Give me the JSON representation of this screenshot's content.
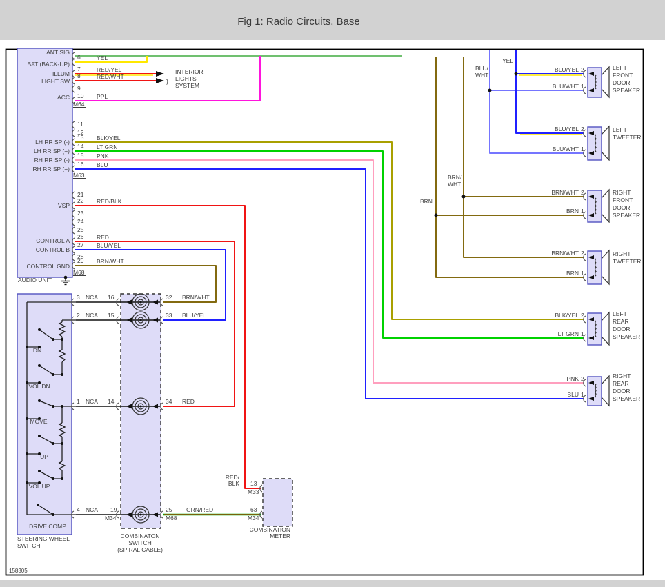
{
  "header": {
    "title": "Fig 1: Radio Circuits, Base"
  },
  "doc_number": "158305",
  "colors": {
    "ant_green": "#70c070",
    "yellow": "#ffe800",
    "red": "#f01414",
    "magenta": "#ff14dd",
    "olive_blk_yel": "#a9a000",
    "lt_grn": "#00d200",
    "pink": "#ff9fbe",
    "blue": "#2020ff",
    "blu_wht": "#7575ff",
    "brown": "#836a10",
    "lavender_box": "#dedcf8",
    "box_border": "#5353c0"
  },
  "audio_unit": {
    "label": "AUDIO UNIT",
    "pin_labels": {
      "ant_sig": "ANT SIG",
      "bat": "BAT (BACK-UP)",
      "illum": "ILLUM",
      "light_sw": "LIGHT SW",
      "acc": "ACC",
      "lh_rr_sp_neg": "LH RR SP (-)",
      "lh_rr_sp_pos": "LH RR SP (+)",
      "rh_rr_sp_neg": "RH RR SP (-)",
      "rh_rr_sp_pos": "RH RR SP (+)",
      "vsp": "VSP",
      "control_a": "CONTROL A",
      "control_b": "CONTROL B",
      "control_gnd": "CONTROL GND"
    },
    "pin_numbers": {
      "p6": "6",
      "p7": "7",
      "p8": "8",
      "p9": "9",
      "p10": "10",
      "p11": "11",
      "p12": "12",
      "p13": "13",
      "p14": "14",
      "p15": "15",
      "p16": "16",
      "p21": "21",
      "p22": "22",
      "p23": "23",
      "p24": "24",
      "p25": "25",
      "p26": "26",
      "p27": "27",
      "p28": "28",
      "p29": "29"
    },
    "wire_labels": {
      "yel": "YEL",
      "red_yel": "RED/YEL",
      "red_wht": "RED/WHT",
      "ppl": "PPL",
      "blk_yel": "BLK/YEL",
      "lt_grn": "LT GRN",
      "pnk": "PNK",
      "blu": "BLU",
      "red_blk": "RED/BLK",
      "red": "RED",
      "blu_yel": "BLU/YEL",
      "brn_wht": "BRN/WHT"
    },
    "connectors": {
      "m64": "M64",
      "m63": "M63",
      "m68": "M68"
    }
  },
  "interior_lights": {
    "line1": "INTERIOR",
    "line2": "LIGHTS",
    "line3": "SYSTEM",
    "brace": "}"
  },
  "steering_wheel_switch": {
    "label1": "STEERING WHEEL",
    "label2": "SWITCH",
    "switches": [
      "DN",
      "VOL DN",
      "MOVE",
      "UP",
      "VOL UP",
      "DRIVE COMP"
    ],
    "pins_left": [
      "3",
      "2",
      "1",
      "4"
    ],
    "nca": "NCA",
    "pins_right": [
      "16",
      "15",
      "14",
      "19"
    ],
    "connector": "M34"
  },
  "spiral_cable": {
    "label1": "COMBINATON",
    "label2": "SWITCH",
    "label3": "(SPIRAL CABLE)",
    "pins": [
      "32",
      "33",
      "34",
      "25"
    ],
    "wires": [
      "BRN/WHT",
      "BLU/YEL",
      "RED",
      "GRN/RED"
    ],
    "connector": "M68"
  },
  "combination_meter": {
    "label1": "COMBINATION",
    "label2": "METER",
    "pin13": "13",
    "pin63": "63",
    "m33": "M33",
    "m34": "M34",
    "wire13a": "RED/",
    "wire13b": "BLK"
  },
  "feeds": {
    "yel": "YEL",
    "blu1": "BLU/",
    "blu2": "WHT",
    "brnw1": "BRN/",
    "brnw2": "WHT",
    "brn": "BRN"
  },
  "speakers": [
    {
      "lines": [
        "LEFT",
        "FRONT",
        "DOOR",
        "SPEAKER"
      ],
      "pin2": "2",
      "pin1": "1",
      "wire2": "BLU/YEL",
      "wire1": "BLU/WHT"
    },
    {
      "lines": [
        "LEFT",
        "TWEETER"
      ],
      "pin2": "2",
      "pin1": "1",
      "wire2": "BLU/YEL",
      "wire1": "BLU/WHT"
    },
    {
      "lines": [
        "RIGHT",
        "FRONT",
        "DOOR",
        "SPEAKER"
      ],
      "pin2": "2",
      "pin1": "1",
      "wire2": "BRN/WHT",
      "wire1": "BRN"
    },
    {
      "lines": [
        "RIGHT",
        "TWEETER"
      ],
      "pin2": "2",
      "pin1": "1",
      "wire2": "BRN/WHT",
      "wire1": "BRN"
    },
    {
      "lines": [
        "LEFT",
        "REAR",
        "DOOR",
        "SPEAKER"
      ],
      "pin2": "2",
      "pin1": "1",
      "wire2": "BLK/YEL",
      "wire1": "LT GRN"
    },
    {
      "lines": [
        "RIGHT",
        "REAR",
        "DOOR",
        "SPEAKER"
      ],
      "pin2": "2",
      "pin1": "1",
      "wire2": "PNK",
      "wire1": "BLU"
    }
  ]
}
